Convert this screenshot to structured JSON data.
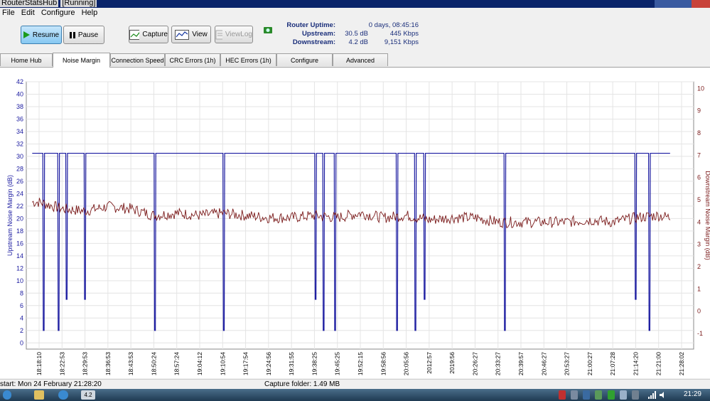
{
  "window": {
    "title": "RouterStatsHub",
    "state": "[Running]"
  },
  "menu": [
    "File",
    "Edit",
    "Configure",
    "Help"
  ],
  "toolbar": {
    "resume_label": "Resume",
    "pause_label": "Pause",
    "capture_label": "Capture",
    "view_label": "View",
    "viewlog_label": "ViewLog"
  },
  "stats": {
    "uptime_label": "Router Uptime:",
    "uptime_value": "0 days, 08:45:16",
    "upstream_label": "Upstream:",
    "upstream_db": "30.5 dB",
    "upstream_rate": "445 Kbps",
    "downstream_label": "Downstream:",
    "downstream_db": "4.2 dB",
    "downstream_rate": "9,151 Kbps"
  },
  "tabs": [
    "Home Hub",
    "Noise Margin",
    "Connection Speed",
    "CRC Errors (1h)",
    "HEC Errors (1h)",
    "Configure",
    "Advanced"
  ],
  "selected_tab": "Noise Margin",
  "chart_data": {
    "type": "line",
    "ylabel": "Upstream Noise Margin (dB)",
    "y2label": "Downstream Noise Margin (dB)",
    "ylim": [
      -1,
      42
    ],
    "y_ticks": [
      "0",
      "2",
      "4",
      "6",
      "8",
      "10",
      "12",
      "14",
      "16",
      "18",
      "20",
      "22",
      "24",
      "26",
      "28",
      "30",
      "32",
      "34",
      "36",
      "38",
      "40",
      "42"
    ],
    "y2lim": [
      -1.7,
      10.3
    ],
    "y2_ticks": [
      "-1",
      "0",
      "1",
      "2",
      "3",
      "4",
      "5",
      "6",
      "7",
      "8",
      "9",
      "10"
    ],
    "x_ticks": [
      "18:18:10",
      "18:22:53",
      "18:29:53",
      "18:36:53",
      "18:43:53",
      "18:50:24",
      "18:57:24",
      "19:04:12",
      "19:10:54",
      "19:17:54",
      "19:24:56",
      "19:31:55",
      "19:38:25",
      "19:45:25",
      "19:52:15",
      "19:58:56",
      "20:05:56",
      "2012:57",
      "2019:56",
      "20:26:27",
      "20:33:27",
      "20:39:57",
      "20:46:27",
      "20:53:27",
      "21:00:27",
      "21:07:28",
      "21:14:20",
      "21:21:00",
      "21:28:02"
    ],
    "grid": true,
    "series": [
      {
        "axis": "left",
        "color": "#1a1aa0",
        "baseline": 30.5,
        "dropouts": [
          {
            "x": 0.2,
            "min": 2
          },
          {
            "x": 0.85,
            "min": 2
          },
          {
            "x": 1.2,
            "min": 7
          },
          {
            "x": 2.0,
            "min": 7
          },
          {
            "x": 5.05,
            "min": 2
          },
          {
            "x": 8.05,
            "min": 2
          },
          {
            "x": 12.05,
            "min": 7
          },
          {
            "x": 12.4,
            "min": 2
          },
          {
            "x": 12.9,
            "min": 2
          },
          {
            "x": 15.6,
            "min": 2
          },
          {
            "x": 16.4,
            "min": 2
          },
          {
            "x": 16.8,
            "min": 7
          },
          {
            "x": 20.3,
            "min": 2
          },
          {
            "x": 26.0,
            "min": 7
          },
          {
            "x": 26.6,
            "min": 2
          }
        ]
      },
      {
        "axis": "right",
        "color": "#7a1a1a",
        "points": [
          [
            0,
            4.9
          ],
          [
            1,
            4.6
          ],
          [
            2,
            4.5
          ],
          [
            3,
            4.7
          ],
          [
            4,
            4.6
          ],
          [
            5,
            4.3
          ],
          [
            6,
            4.4
          ],
          [
            7,
            4.3
          ],
          [
            8,
            4.4
          ],
          [
            9,
            4.3
          ],
          [
            10,
            4.2
          ],
          [
            11,
            4.2
          ],
          [
            12,
            4.3
          ],
          [
            13,
            4.2
          ],
          [
            14,
            4.4
          ],
          [
            15,
            4.2
          ],
          [
            16,
            4.3
          ],
          [
            17,
            4.1
          ],
          [
            18,
            4.2
          ],
          [
            19,
            4.2
          ],
          [
            20,
            4.0
          ],
          [
            21,
            4.0
          ],
          [
            22,
            4.0
          ],
          [
            23,
            4.0
          ],
          [
            24,
            4.1
          ],
          [
            25,
            4.0
          ],
          [
            26,
            4.2
          ],
          [
            27,
            4.3
          ],
          [
            27.5,
            4.2
          ]
        ]
      }
    ]
  },
  "status": {
    "start_text": "start: Mon 24 February 21:28:20",
    "capture_folder": "Capture folder:  1.49 MB"
  },
  "taskbar": {
    "task_label": "4.2",
    "clock": "21:29"
  },
  "colors": {
    "upstream": "#1a1aa0",
    "downstream": "#7a1a1a",
    "label_blue": "#1a2e7a"
  }
}
